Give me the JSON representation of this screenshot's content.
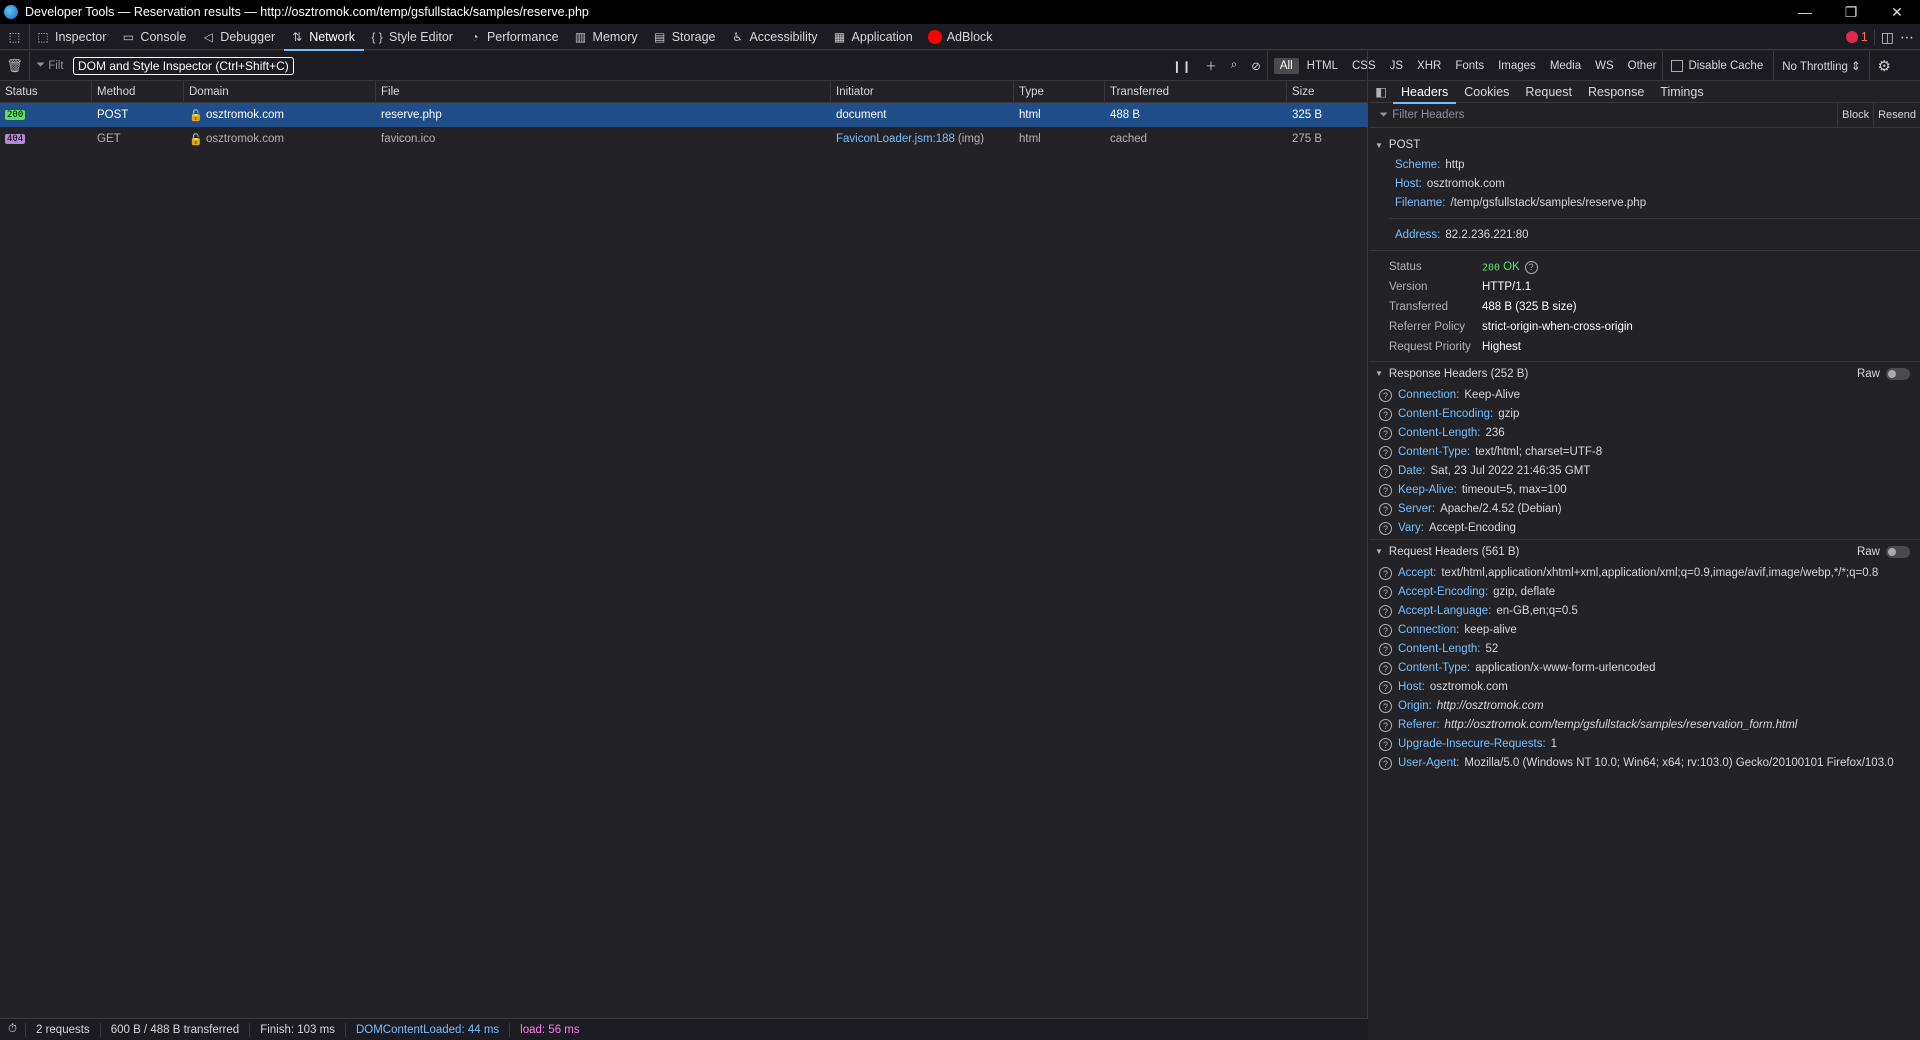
{
  "window": {
    "title": "Developer Tools — Reservation results — http://osztromok.com/temp/gsfullstack/samples/reserve.php"
  },
  "toolbar": {
    "tabs": [
      {
        "label": "Inspector",
        "icon": "inspector-icon"
      },
      {
        "label": "Console",
        "icon": "console-icon"
      },
      {
        "label": "Debugger",
        "icon": "debugger-icon"
      },
      {
        "label": "Network",
        "icon": "network-icon"
      },
      {
        "label": "Style Editor",
        "icon": "braces-icon"
      },
      {
        "label": "Performance",
        "icon": "gauge-icon"
      },
      {
        "label": "Memory",
        "icon": "memory-icon"
      },
      {
        "label": "Storage",
        "icon": "storage-icon"
      },
      {
        "label": "Accessibility",
        "icon": "accessibility-icon"
      },
      {
        "label": "Application",
        "icon": "grid-icon"
      },
      {
        "label": "AdBlock",
        "icon": "adblock-icon"
      }
    ],
    "selected_tab": "Network",
    "error_count": "1"
  },
  "filter": {
    "placeholder": "Filt",
    "tooltip": "DOM and Style Inspector (Ctrl+Shift+C)",
    "types": [
      "All",
      "HTML",
      "CSS",
      "JS",
      "XHR",
      "Fonts",
      "Images",
      "Media",
      "WS",
      "Other"
    ],
    "selected_type": "All",
    "disable_cache_label": "Disable Cache",
    "throttling_label": "No Throttling ⇕"
  },
  "table": {
    "columns": [
      "Status",
      "Method",
      "Domain",
      "File",
      "Initiator",
      "Type",
      "Transferred",
      "Size"
    ],
    "rows": [
      {
        "status": "200",
        "method": "POST",
        "domain": "osztromok.com",
        "file": "reserve.php",
        "initiator": "document",
        "type": "html",
        "transferred": "488 B",
        "size": "325 B"
      },
      {
        "status": "404",
        "method": "GET",
        "domain": "osztromok.com",
        "file": "favicon.ico",
        "initiator": "FaviconLoader.jsm:188",
        "initiator_suffix": "(img)",
        "type": "html",
        "transferred": "cached",
        "size": "275 B"
      }
    ]
  },
  "statusbar": {
    "requests": "2 requests",
    "transferred": "600 B / 488 B transferred",
    "finish": "Finish: 103 ms",
    "dcl": "DOMContentLoaded: 44 ms",
    "load": "load: 56 ms"
  },
  "details": {
    "tabs": [
      "Headers",
      "Cookies",
      "Request",
      "Response",
      "Timings"
    ],
    "selected_tab": "Headers",
    "filter_placeholder": "Filter Headers",
    "block_label": "Block",
    "resend_label": "Resend",
    "method": "POST",
    "scheme_k": "Scheme:",
    "scheme_v": "http",
    "host_k": "Host:",
    "host_v": "osztromok.com",
    "filename_k": "Filename:",
    "filename_v": "/temp/gsfullstack/samples/reserve.php",
    "address_k": "Address:",
    "address_v": "82.2.236.221:80",
    "summary": [
      {
        "k": "Status",
        "v": "200",
        "v2": "OK"
      },
      {
        "k": "Version",
        "v": "HTTP/1.1"
      },
      {
        "k": "Transferred",
        "v": "488 B (325 B size)"
      },
      {
        "k": "Referrer Policy",
        "v": "strict-origin-when-cross-origin"
      },
      {
        "k": "Request Priority",
        "v": "Highest"
      }
    ],
    "raw_label": "Raw",
    "response_headers_title": "Response Headers (252 B)",
    "response_headers": [
      {
        "k": "Connection:",
        "v": "Keep-Alive"
      },
      {
        "k": "Content-Encoding:",
        "v": "gzip"
      },
      {
        "k": "Content-Length:",
        "v": "236"
      },
      {
        "k": "Content-Type:",
        "v": "text/html; charset=UTF-8"
      },
      {
        "k": "Date:",
        "v": "Sat, 23 Jul 2022 21:46:35 GMT"
      },
      {
        "k": "Keep-Alive:",
        "v": "timeout=5, max=100"
      },
      {
        "k": "Server:",
        "v": "Apache/2.4.52 (Debian)"
      },
      {
        "k": "Vary:",
        "v": "Accept-Encoding"
      }
    ],
    "request_headers_title": "Request Headers (561 B)",
    "request_headers": [
      {
        "k": "Accept:",
        "v": "text/html,application/xhtml+xml,application/xml;q=0.9,image/avif,image/webp,*/*;q=0.8"
      },
      {
        "k": "Accept-Encoding:",
        "v": "gzip, deflate"
      },
      {
        "k": "Accept-Language:",
        "v": "en-GB,en;q=0.5"
      },
      {
        "k": "Connection:",
        "v": "keep-alive"
      },
      {
        "k": "Content-Length:",
        "v": "52"
      },
      {
        "k": "Content-Type:",
        "v": "application/x-www-form-urlencoded"
      },
      {
        "k": "Host:",
        "v": "osztromok.com"
      },
      {
        "k": "Origin:",
        "v": "http://osztromok.com",
        "italic": true
      },
      {
        "k": "Referer:",
        "v": "http://osztromok.com/temp/gsfullstack/samples/reservation_form.html",
        "italic": true
      },
      {
        "k": "Upgrade-Insecure-Requests:",
        "v": "1"
      },
      {
        "k": "User-Agent:",
        "v": "Mozilla/5.0 (Windows NT 10.0; Win64; x64; rv:103.0) Gecko/20100101 Firefox/103.0"
      }
    ]
  }
}
